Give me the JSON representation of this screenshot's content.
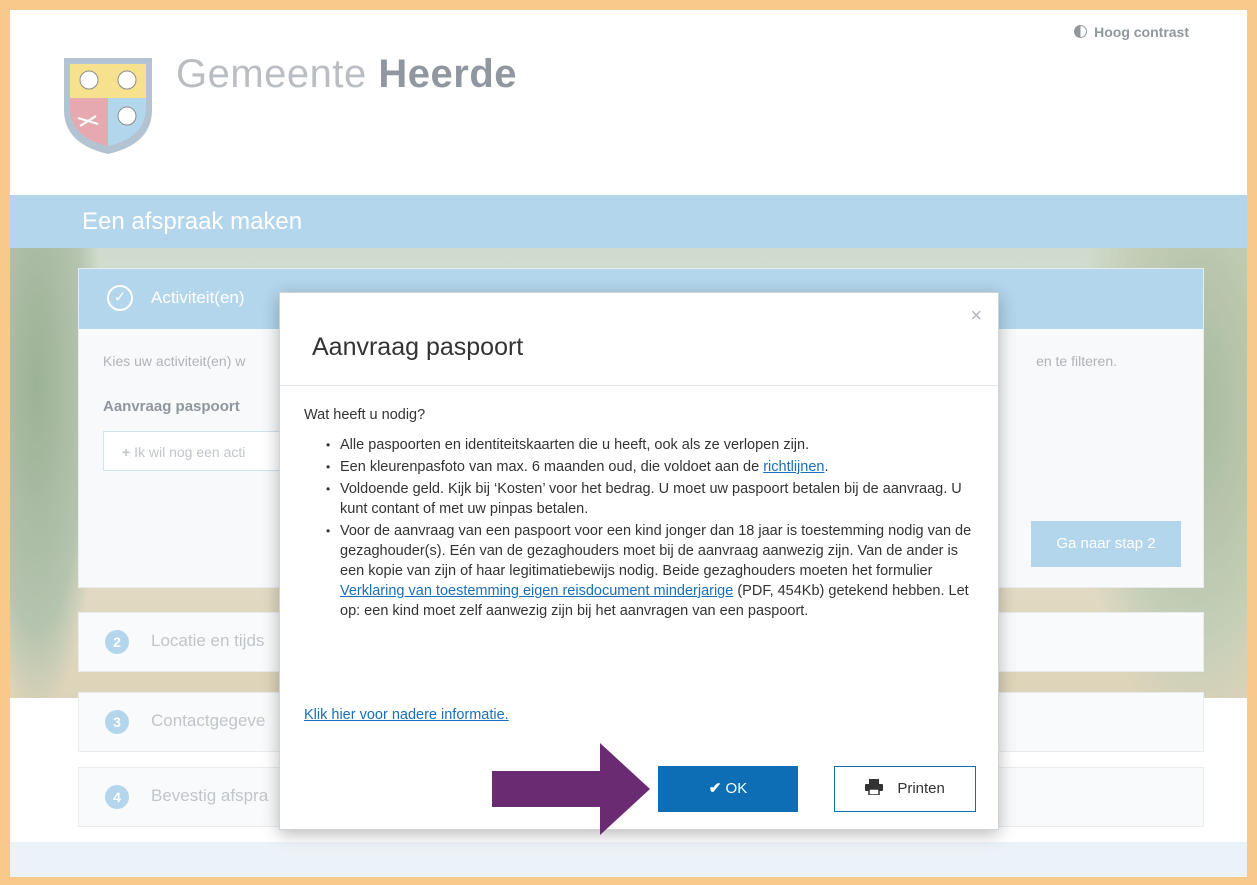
{
  "site": {
    "brand_light": "Gemeente",
    "brand_bold": "Heerde",
    "contrast_label": "Hoog contrast",
    "page_title": "Een afspraak maken"
  },
  "step1": {
    "label": "Activiteit(en)",
    "intro_left": "Kies uw activiteit(en) w",
    "intro_right": "en te filteren.",
    "activity": "Aanvraag paspoort",
    "add_label": "Ik wil nog een acti",
    "next_label": "Ga naar stap 2"
  },
  "steps": [
    {
      "num": "2",
      "label": "Locatie en tijds"
    },
    {
      "num": "3",
      "label": "Contactgegeve"
    },
    {
      "num": "4",
      "label": "Bevestig afspra"
    }
  ],
  "modal": {
    "title": "Aanvraag paspoort",
    "close": "×",
    "question": "Wat heeft u nodig?",
    "items": {
      "i1": "Alle paspoorten en identiteitskaarten die u heeft, ook als ze verlopen zijn.",
      "i2_before": "Een kleurenpasfoto van max. 6 maanden oud, die voldoet aan de ",
      "i2_link": "richtlijnen",
      "i2_after": ".",
      "i3": "Voldoende geld. Kijk bij ‘Kosten’ voor het bedrag. U moet uw paspoort betalen bij de aanvraag. U kunt contant of met uw pinpas betalen.",
      "i4_before": "Voor de aanvraag van een paspoort voor een kind jonger dan 18 jaar is toestemming nodig van de gezaghouder(s). Eén van de gezaghouders moet bij de aanvraag aanwezig zijn. Van de ander is een kopie van zijn of haar legitimatiebewijs nodig. Beide gezaghouders moeten het formulier ",
      "i4_link": "Verklaring van toestemming eigen reisdocument minderjarige",
      "i4_after": " (PDF, 454Kb) getekend hebben. Let op: een kind moet zelf aanwezig zijn bij het aanvragen van een paspoort."
    },
    "more_link": "Klik hier voor nadere informatie.",
    "ok_label": "OK",
    "print_label": "Printen"
  },
  "colors": {
    "accent_blue": "#8fc3e4",
    "primary_button": "#0d6eb5",
    "arrow": "#6b2b72",
    "frame": "#f9c98b"
  }
}
